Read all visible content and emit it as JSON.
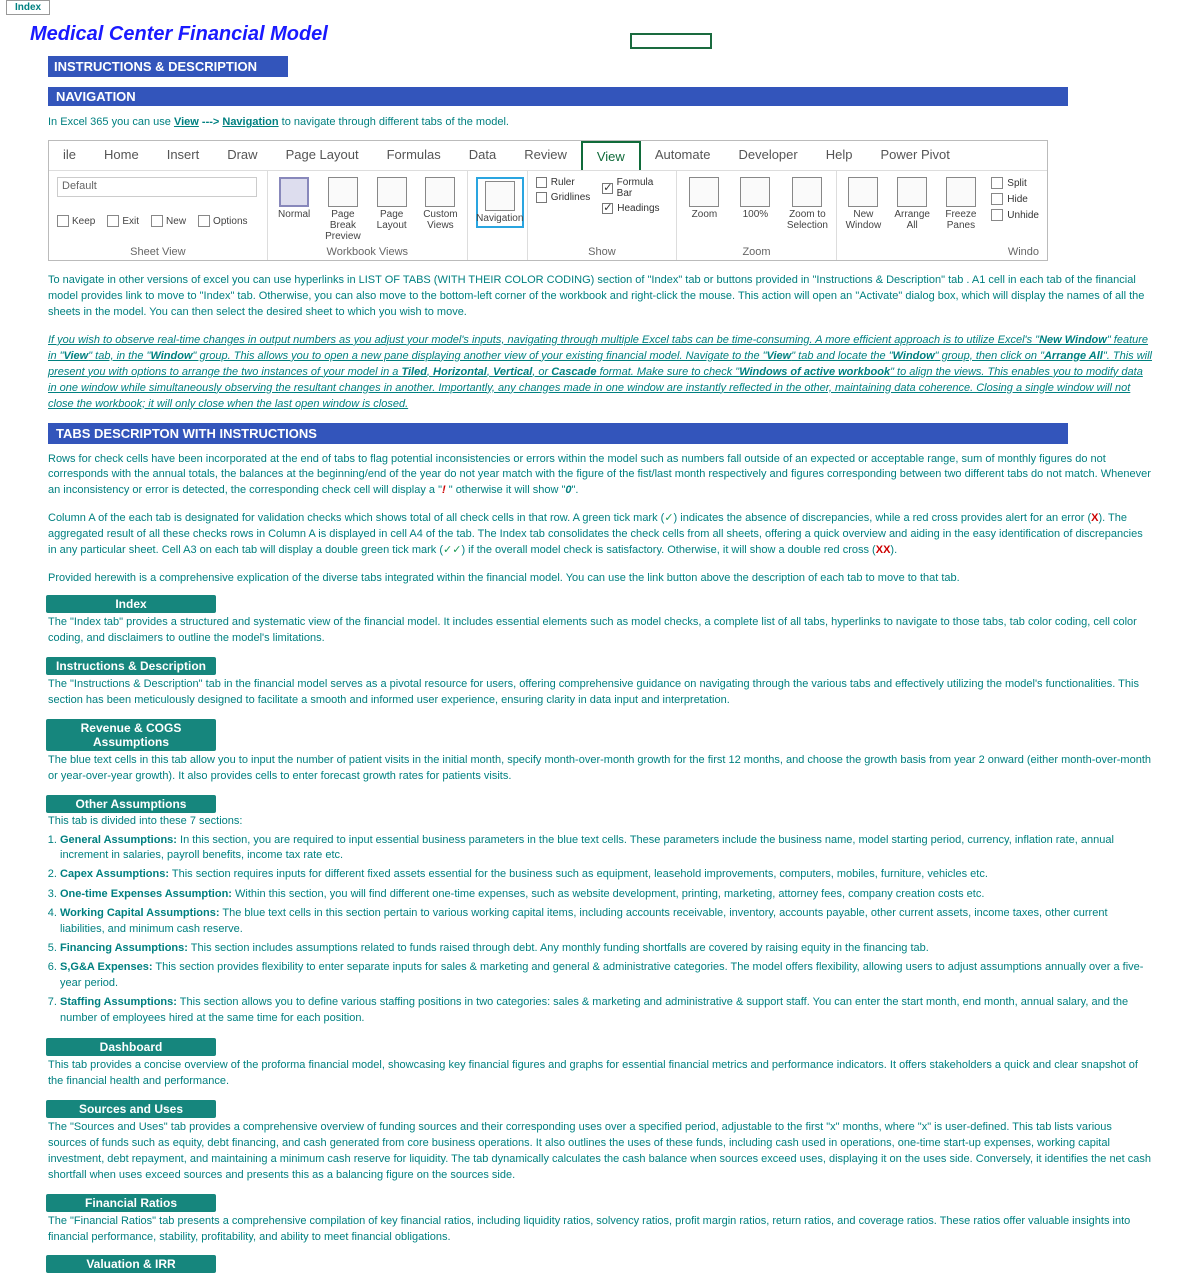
{
  "tab": "Index",
  "title": "Medical Center Financial Model",
  "sec1": "INSTRUCTIONS & DESCRIPTION",
  "navbar": "NAVIGATION",
  "navhint_p1": "In Excel 365 you can use ",
  "navhint_view": "View",
  "navhint_arrow": " ---> ",
  "navhint_nav": "Navigation",
  "navhint_p2": " to navigate through different tabs of the model.",
  "menu": {
    "file": "ile",
    "home": "Home",
    "insert": "Insert",
    "draw": "Draw",
    "pagelayout": "Page Layout",
    "formulas": "Formulas",
    "data": "Data",
    "review": "Review",
    "view": "View",
    "automate": "Automate",
    "developer": "Developer",
    "help": "Help",
    "powerpivot": "Power Pivot"
  },
  "ribbon": {
    "default": "Default",
    "keep": "Keep",
    "exit": "Exit",
    "new": "New",
    "options": "Options",
    "sheetview": "Sheet View",
    "normal": "Normal",
    "pagebreak": "Page Break Preview",
    "pagelayout": "Page Layout",
    "custom": "Custom Views",
    "workbook": "Workbook Views",
    "navigation": "Navigation",
    "ruler": "Ruler",
    "formulabar": "Formula Bar",
    "gridlines": "Gridlines",
    "headings": "Headings",
    "show": "Show",
    "zoom": "Zoom",
    "h100": "100%",
    "zoomsel": "Zoom to Selection",
    "newwin": "New Window",
    "arrange": "Arrange All",
    "freeze": "Freeze Panes",
    "split": "Split",
    "hide": "Hide",
    "unhide": "Unhide",
    "windo": "Windo"
  },
  "p_nav": "To navigate in other versions of excel you can use hyperlinks in LIST OF TABS (WITH THEIR COLOR CODING) section of \"Index\" tab or buttons provided in  \"Instructions & Description\" tab . A1 cell in each tab of the financial model provides link to move to \"Index\" tab. Otherwise, you can also move to the bottom-left corner of the workbook and right-click the mouse. This action will open an \"Activate\" dialog box, which will display the names of all the sheets in the model. You can then select the desired sheet to which you wish to move.",
  "p_it1_a": "If you wish to observe real-time changes in output numbers as you adjust your model's inputs, navigating through multiple Excel tabs can be time-consuming. A more efficient approach is to utilize Excel's \"",
  "p_it1_newwin": "New Window",
  "p_it1_b": "\" feature in \"",
  "p_it1_view": "View",
  "p_it1_c": "\" tab, in the \"",
  "p_it1_window": "Window",
  "p_it1_d": "\" group. This allows you to open a new pane displaying another view of your existing financial model. Navigate to the \"",
  "p_it1_view2": "View",
  "p_it1_e": "\" tab and locate the \"",
  "p_it1_window2": "Window",
  "p_it1_f": "\" group, then click on \"",
  "p_it1_arrange": "Arrange All",
  "p_it1_g": "\". This will present you with options to arrange the two instances of your model in a ",
  "p_it1_tiled": "Tiled",
  "p_it1_h": ", ",
  "p_it1_horiz": "Horizontal",
  "p_it1_vert": "Vertical",
  "p_it1_or": ", or ",
  "p_it1_casc": "Cascade",
  "p_it1_i": " format. Make sure to check \"",
  "p_it1_active": "Windows of active workbook",
  "p_it1_j": "\" to align the views. This  enables you to modify data in one window while simultaneously observing the resultant changes in another. Importantly, any changes made in one window are instantly reflected in the other, maintaining data coherence. Closing a single window will not close the workbook; it will only close when the last open window is closed.",
  "sec_tabs": "TABS DESCRIPTON WITH INSTRUCTIONS",
  "p_rows1": "Rows for check cells have been incorporated at the end of tabs to flag potential inconsistencies or errors within the model such as numbers fall outside of an expected or acceptable range, sum of monthly figures do not corresponds with the annual totals, the balances at the beginning/end of the year do not year match with the figure of the fist/last month respectively and figures corresponding between two different tabs do not match. Whenever an inconsistency or error is detected, the corresponding check cell will display a \"",
  "p_rows_bang": "!",
  "p_rows2": " \" otherwise it will show \"",
  "p_rows_zero": "0",
  "p_rows3": "\".",
  "p_colA1": "Column A of the each tab is designated for validation checks which shows total of all check cells in that row. A green tick mark (",
  "p_colA_tick": "✓",
  "p_colA2": ") indicates the absence of discrepancies, while a red cross provides alert for an error (",
  "p_colA_x": "X",
  "p_colA3": "). The aggregated result of all these checks rows in Column A is displayed in cell A4 of the tab. The Index tab consolidates the check cells from all sheets, offering a quick overview and aiding in the easy identification of discrepancies in any particular sheet. Cell A3 on each tab will display a double green tick mark (",
  "p_colA_dtick": "✓✓",
  "p_colA4": ") if the overall model check is satisfactory. Otherwise, it will show a double red cross (",
  "p_colA_dx": "XX",
  "p_colA5": ").",
  "p_provided": "Provided herewith is a comprehensive explication of the diverse tabs integrated within the financial model. You can use the link button above the description of each tab to move to that tab.",
  "btn_index": "Index",
  "d_index": "The \"Index tab\" provides a structured and systematic view of the financial model. It includes essential elements such as model checks, a complete list of all tabs, hyperlinks to navigate to those tabs, tab color coding, cell color coding, and disclaimers to outline the model's limitations.",
  "btn_instr": "Instructions & Description",
  "d_instr": "The \"Instructions & Description\" tab in the financial model serves as a pivotal resource for users, offering comprehensive guidance on navigating through the various tabs and effectively utilizing the model's functionalities. This section has been meticulously designed to facilitate a smooth and informed user experience, ensuring clarity in data input and interpretation.",
  "btn_rev": "Revenue & COGS Assumptions",
  "d_rev": "The blue text cells in this tab allow you to input the number of patient visits in the initial month, specify month-over-month growth for the first 12 months, and choose the growth basis from year 2 onward (either month-over-month or year-over-year growth). It also provides cells to enter forecast growth rates for patients visits.",
  "btn_other": "Other Assumptions",
  "d_other_intro": "This tab is divided into these 7 sections:",
  "items": [
    {
      "b": "General Assumptions:",
      "t": " In this section, you are required to input essential business parameters in the blue text cells. These parameters include the business name, model starting period, currency, inflation rate, annual increment in salaries, payroll benefits, income tax rate etc."
    },
    {
      "b": "Capex Assumptions:",
      "t": " This section requires inputs for different fixed assets essential for the business such as equipment, leasehold improvements, computers, mobiles, furniture, vehicles etc."
    },
    {
      "b": "One-time Expenses Assumption:",
      "t": " Within this section, you will find different one-time expenses, such as website development, printing, marketing, attorney fees, company creation costs etc."
    },
    {
      "b": "Working Capital Assumptions:",
      "t": " The blue text cells in this section pertain to various working capital items, including accounts receivable, inventory, accounts payable, other current assets, income taxes, other current liabilities, and minimum cash reserve."
    },
    {
      "b": "Financing Assumptions:",
      "t": " This section includes assumptions related to funds raised through debt. Any monthly funding shortfalls are covered by raising equity in the financing tab."
    },
    {
      "b": "S,G&A Expenses:",
      "t": " This section provides flexibility to enter separate inputs for sales & marketing and general & administrative categories.  The model offers flexibility, allowing users to adjust assumptions annually  over a five-year period."
    },
    {
      "b": "Staffing Assumptions:",
      "t": " This section allows you to define various staffing positions in two categories: sales & marketing and administrative & support staff. You can enter the start month, end month, annual salary, and the number of employees hired at the same time for each position."
    }
  ],
  "btn_dash": "Dashboard",
  "d_dash": "This tab provides a concise overview of the proforma financial model, showcasing key financial figures and graphs for essential financial metrics and performance indicators. It offers stakeholders a quick and clear snapshot of the financial health and performance.",
  "btn_src": "Sources and Uses",
  "d_src": "The \"Sources and Uses\" tab provides a comprehensive overview of funding sources and their corresponding uses over a specified period, adjustable to the first \"x\" months, where \"x\" is user-defined. This tab lists various sources of funds such as equity, debt financing, and cash generated from core business operations. It also outlines the uses of these funds, including cash used in operations, one-time start-up expenses, working capital investment, debt repayment, and maintaining  a minimum cash reserve for liquidity. The tab dynamically calculates the cash balance when sources exceed uses, displaying it on the uses side. Conversely, it identifies the net cash shortfall when uses exceed sources and presents this as a balancing figure on the sources side.",
  "btn_fin": "Financial Ratios",
  "d_fin": "The \"Financial Ratios\" tab presents a comprehensive compilation of key financial ratios, including liquidity ratios, solvency ratios, profit margin ratios, return ratios, and coverage ratios. These ratios offer valuable insights into financial performance, stability, profitability, and ability to meet financial obligations.",
  "btn_val": "Valuation & IRR"
}
